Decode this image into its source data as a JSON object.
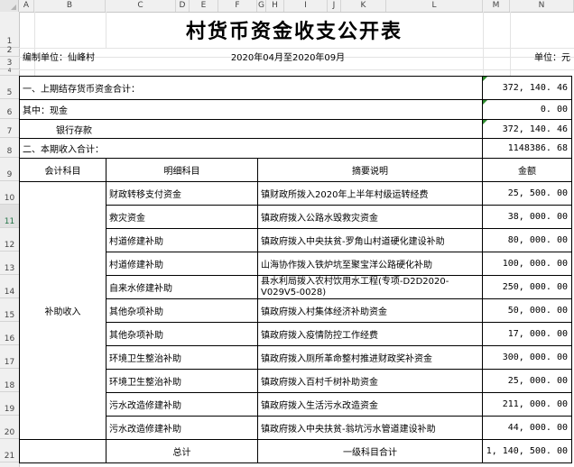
{
  "columns": [
    "A",
    "B",
    "C",
    "D",
    "E",
    "F",
    "G",
    "H",
    "I",
    "J",
    "K",
    "L",
    "M",
    "N"
  ],
  "rows": [
    "1",
    "2",
    "3",
    "4",
    "5",
    "6",
    "7",
    "8",
    "9",
    "10",
    "11",
    "12",
    "13",
    "14",
    "15",
    "16",
    "17",
    "18",
    "19",
    "20",
    "21"
  ],
  "sheet": {
    "title": "村货币资金收支公开表",
    "unit_label": "编制单位：仙峰村",
    "period": "2020年04月至2020年09月",
    "currency_unit": "单位：元",
    "summary": [
      {
        "label": "一、上期结存货币资金合计：",
        "value": "372, 140. 46"
      },
      {
        "label": "其中：现金",
        "value": "0. 00"
      },
      {
        "label": "银行存款",
        "value": "372, 140. 46"
      },
      {
        "label": "二、本期收入合计：",
        "value": "1148386. 68"
      }
    ],
    "headers": {
      "account": "会计科目",
      "detail": "明细科目",
      "description": "摘要说明",
      "amount": "金额"
    },
    "group_label": "补助收入",
    "items": [
      {
        "detail": "财政转移支付资金",
        "description": "镇财政所拨入2020年上半年村级运转经费",
        "amount": "25, 500. 00"
      },
      {
        "detail": "救灾资金",
        "description": "镇政府拨入公路水毁救灾资金",
        "amount": "38, 000. 00"
      },
      {
        "detail": "村道修建补助",
        "description": "镇政府拨入中央扶贫-罗角山村道硬化建设补助",
        "amount": "80, 000. 00"
      },
      {
        "detail": "村道修建补助",
        "description": "山海协作拨入铁炉坑至聚宝洋公路硬化补助",
        "amount": "100, 000. 00"
      },
      {
        "detail": "自来水修建补助",
        "description": "县水利局拨入农村饮用水工程(专项-D2D2020-V029V5-0028)",
        "amount": "250, 000. 00"
      },
      {
        "detail": "其他杂项补助",
        "description": "镇政府拨入村集体经济补助资金",
        "amount": "50, 000. 00"
      },
      {
        "detail": "其他杂项补助",
        "description": "镇政府拨入疫情防控工作经费",
        "amount": "17, 000. 00"
      },
      {
        "detail": "环境卫生整治补助",
        "description": "镇政府拨入厕所革命整村推进财政奖补资金",
        "amount": "300, 000. 00"
      },
      {
        "detail": "环境卫生整治补助",
        "description": "镇政府拨入百村千树补助资金",
        "amount": "25, 000. 00"
      },
      {
        "detail": "污水改造修建补助",
        "description": "镇政府拨入生活污水改造资金",
        "amount": "211, 000. 00"
      },
      {
        "detail": "污水改造修建补助",
        "description": "镇政府拨入中央扶贫-翁坑污水管道建设补助",
        "amount": "44, 000. 00"
      }
    ],
    "footer": {
      "total_label": "总计",
      "subtotal_label": "一级科目合计",
      "total_amount": "1, 140, 500. 00"
    }
  },
  "colors": {
    "grid": "#e3e3e3",
    "header_bg": "#f0f0f0",
    "note_triangle": "#2e8b2e"
  }
}
